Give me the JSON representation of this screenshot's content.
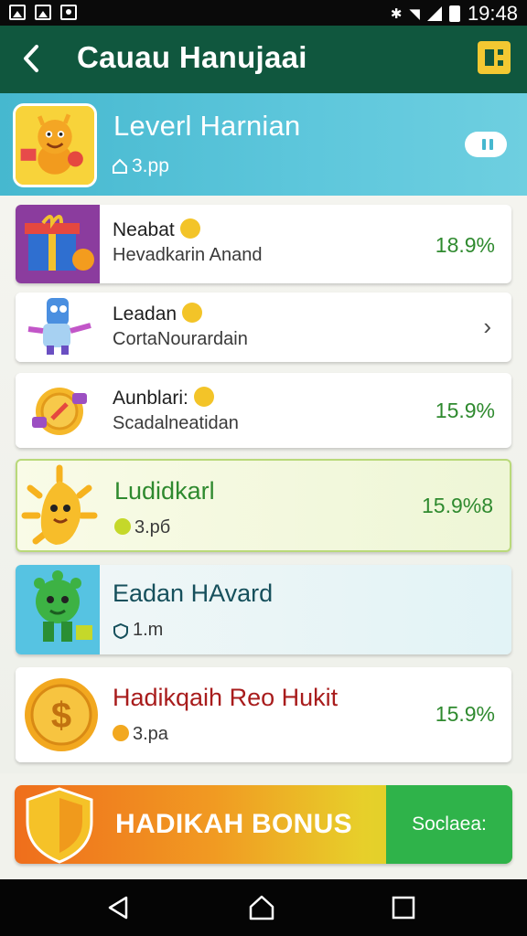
{
  "status_bar": {
    "time": "19:48"
  },
  "app_bar": {
    "title": "Cauau Hanujaai"
  },
  "level": {
    "title": "Leverl Harnian",
    "points": "3.pp"
  },
  "items": [
    {
      "title": "Neabat",
      "subtitle": "Hevadkarin Anand",
      "value": "18.9%"
    },
    {
      "title": "Leadan",
      "subtitle": "CortaNourardain",
      "value": ""
    },
    {
      "title": "Aunblari:",
      "subtitle": "Scadalneatidan",
      "value": "15.9%"
    },
    {
      "title": "Ludidkarl",
      "subtitle": "3.pб",
      "value": "15.9%8"
    },
    {
      "title": "Eadan HAvard",
      "subtitle": "1.m",
      "value": ""
    },
    {
      "title": "Hadikqaih Reo Hukit",
      "subtitle": "3.pa",
      "value": "15.9%"
    }
  ],
  "bonus": {
    "label": "HADIKAH BONUS",
    "button": "Soclaea:"
  },
  "colors": {
    "appbar": "#10573e",
    "level": "#46b8cf",
    "value_green": "#2f8a2f",
    "bonus_button": "#2fb34a"
  }
}
